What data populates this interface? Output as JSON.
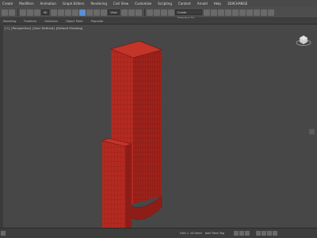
{
  "menu": {
    "items": [
      "Create",
      "Modifiers",
      "Animation",
      "Graph Editors",
      "Rendering",
      "Civil View",
      "Customize",
      "Scripting",
      "Content",
      "Arnold",
      "Help",
      "3DXCHANGE"
    ]
  },
  "toolbar": {
    "filter": "All",
    "view": "View",
    "selection_set": "Create Selection Se"
  },
  "ribbon": {
    "tabs": [
      "Modeling",
      "Freeform",
      "Selection",
      "Object Paint",
      "Populate"
    ]
  },
  "viewport": {
    "label": [
      "[+]",
      "[Perspective]",
      "[User Defined]",
      "[Default Shading]"
    ],
    "object_color": "#b52a22",
    "edge_color": "#6e1410"
  },
  "status": {
    "grid": "Grid = 10.0mm",
    "add_time_tag": "Add Time Tag"
  }
}
